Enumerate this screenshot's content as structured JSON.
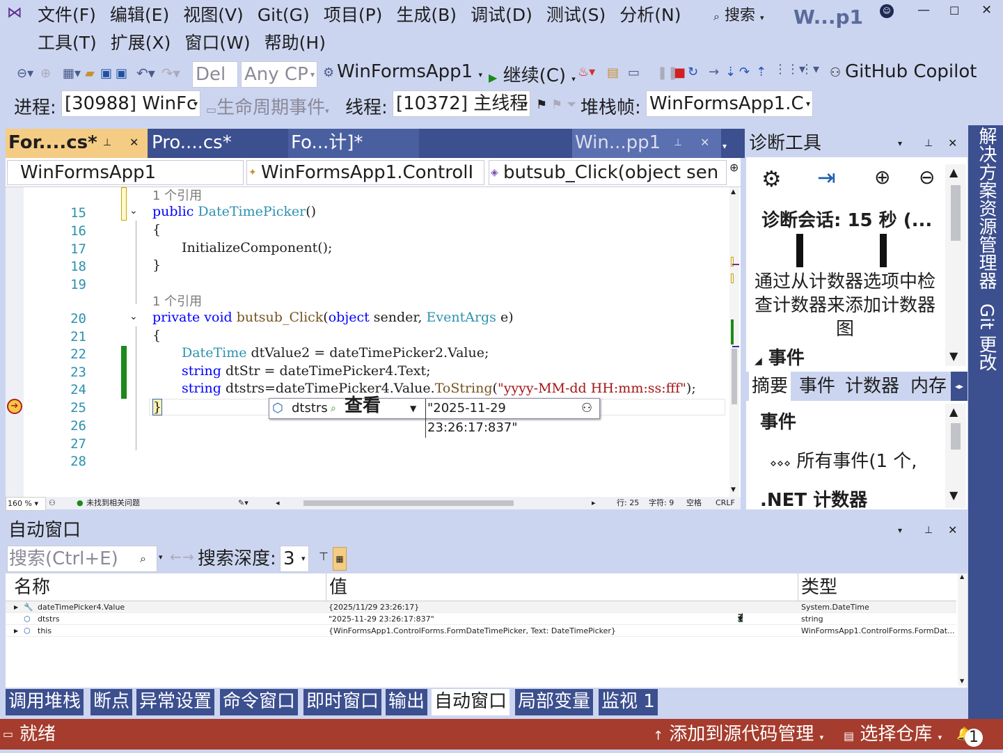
{
  "colors": {
    "accent": "#3c4f8f",
    "chrome": "#ccd5f0",
    "status": "#a53c2d",
    "current_line": "#ff3333"
  },
  "menu": {
    "row1": [
      "文件(F)",
      "编辑(E)",
      "视图(V)",
      "Git(G)",
      "项目(P)",
      "生成(B)",
      "调试(D)",
      "测试(S)",
      "分析(N)"
    ],
    "row2": [
      "工具(T)",
      "扩展(X)",
      "窗口(W)",
      "帮助(H)"
    ],
    "search": "搜索",
    "solution": "W...p1"
  },
  "toolbar1": {
    "config": "Del",
    "platform": "Any CP",
    "startup": "WinFormsApp1",
    "continue": "继续(C)",
    "copilot": "GitHub Copilot"
  },
  "toolbar2": {
    "process_label": "进程:",
    "process": "[30988] WinFc",
    "lifecycle": "生命周期事件",
    "thread_label": "线程:",
    "thread": "[10372] 主线程",
    "frame_label": "堆栈帧:",
    "frame": "WinFormsApp1.C"
  },
  "doc_tabs": [
    "For....cs*",
    "Pro....cs*",
    "Fo...计]*",
    "Win...pp1"
  ],
  "navbar": {
    "project": "WinFormsApp1",
    "class": "WinFormsApp1.ControlI",
    "member": "butsub_Click(object sen"
  },
  "code": {
    "ref1": "1 个引用",
    "ref2": "1 个引用",
    "lines": [
      "15",
      "16",
      "17",
      "18",
      "19",
      "20",
      "21",
      "22",
      "23",
      "24",
      "25",
      "26",
      "27",
      "28"
    ],
    "l15a": "public ",
    "l15b": "DateTimePicker",
    "l15c": "()",
    "l16": "{",
    "l17": "InitializeComponent();",
    "l18": "}",
    "l20a": "private void ",
    "l20b": "butsub_Click",
    "l20c": "(",
    "l20d": "object ",
    "l20e": "sender, ",
    "l20f": "EventArgs ",
    "l20g": "e)",
    "l21": "{",
    "l22a": "DateTime ",
    "l22b": "dtValue2 = dateTimePicker2.Value;",
    "l23a": "string ",
    "l23b": "dtStr = dateTimePicker4.Text;",
    "l24a": "string ",
    "l24b": "dtstrs=dateTimePicker4.Value.",
    "l24c": "ToString",
    "l24d": "(",
    "l24e": "\"yyyy-MM-dd HH:mm:ss:fff\"",
    "l24f": ");",
    "l25": "}"
  },
  "datatip": {
    "name": "dtstrs",
    "view": "查看",
    "value": "\"2025-11-29 23:26:17:837\""
  },
  "editor_status": {
    "zoom": "160 %",
    "issues": "未找到相关问题",
    "line": "行: 25",
    "char": "字符: 9",
    "space": "空格",
    "eol": "CRLF"
  },
  "diag": {
    "title": "诊断工具",
    "session": "诊断会话: 15 秒 (...",
    "hint": "通过从计数器选项中检查计数器来添加计数器图",
    "events_header": "事件",
    "tabs": [
      "摘要",
      "事件",
      "计数器",
      "内存"
    ],
    "events_label": "事件",
    "all_events": "所有事件(1 个,",
    "net_counters": ".NET 计数器"
  },
  "side_strip": {
    "solution_explorer": "解决方案资源管理器",
    "git": "Git 更改"
  },
  "autos": {
    "title": "自动窗口",
    "search_placeholder": "搜索(Ctrl+E)",
    "depth_label": "搜索深度:",
    "depth": "3",
    "headers": [
      "名称",
      "值",
      "类型"
    ],
    "rows": [
      {
        "name": "dateTimePicker4.Value",
        "value": "{2025/11/29 23:26:17}",
        "type": "System.DateTime"
      },
      {
        "name": "dtstrs",
        "value": "\"2025-11-29 23:26:17:837\"",
        "type": "string",
        "view": "查看"
      },
      {
        "name": "this",
        "value": "{WinFormsApp1.ControlForms.FormDateTimePicker, Text: DateTimePicker}",
        "type": "WinFormsApp1.ControlForms.FormDat..."
      }
    ]
  },
  "bottom_tabs": [
    "调用堆栈",
    "断点",
    "异常设置",
    "命令窗口",
    "即时窗口",
    "输出",
    "自动窗口",
    "局部变量",
    "监视 1"
  ],
  "statusbar": {
    "ready": "就绪",
    "add_source": "添加到源代码管理",
    "select_repo": "选择仓库",
    "notif": "1"
  }
}
